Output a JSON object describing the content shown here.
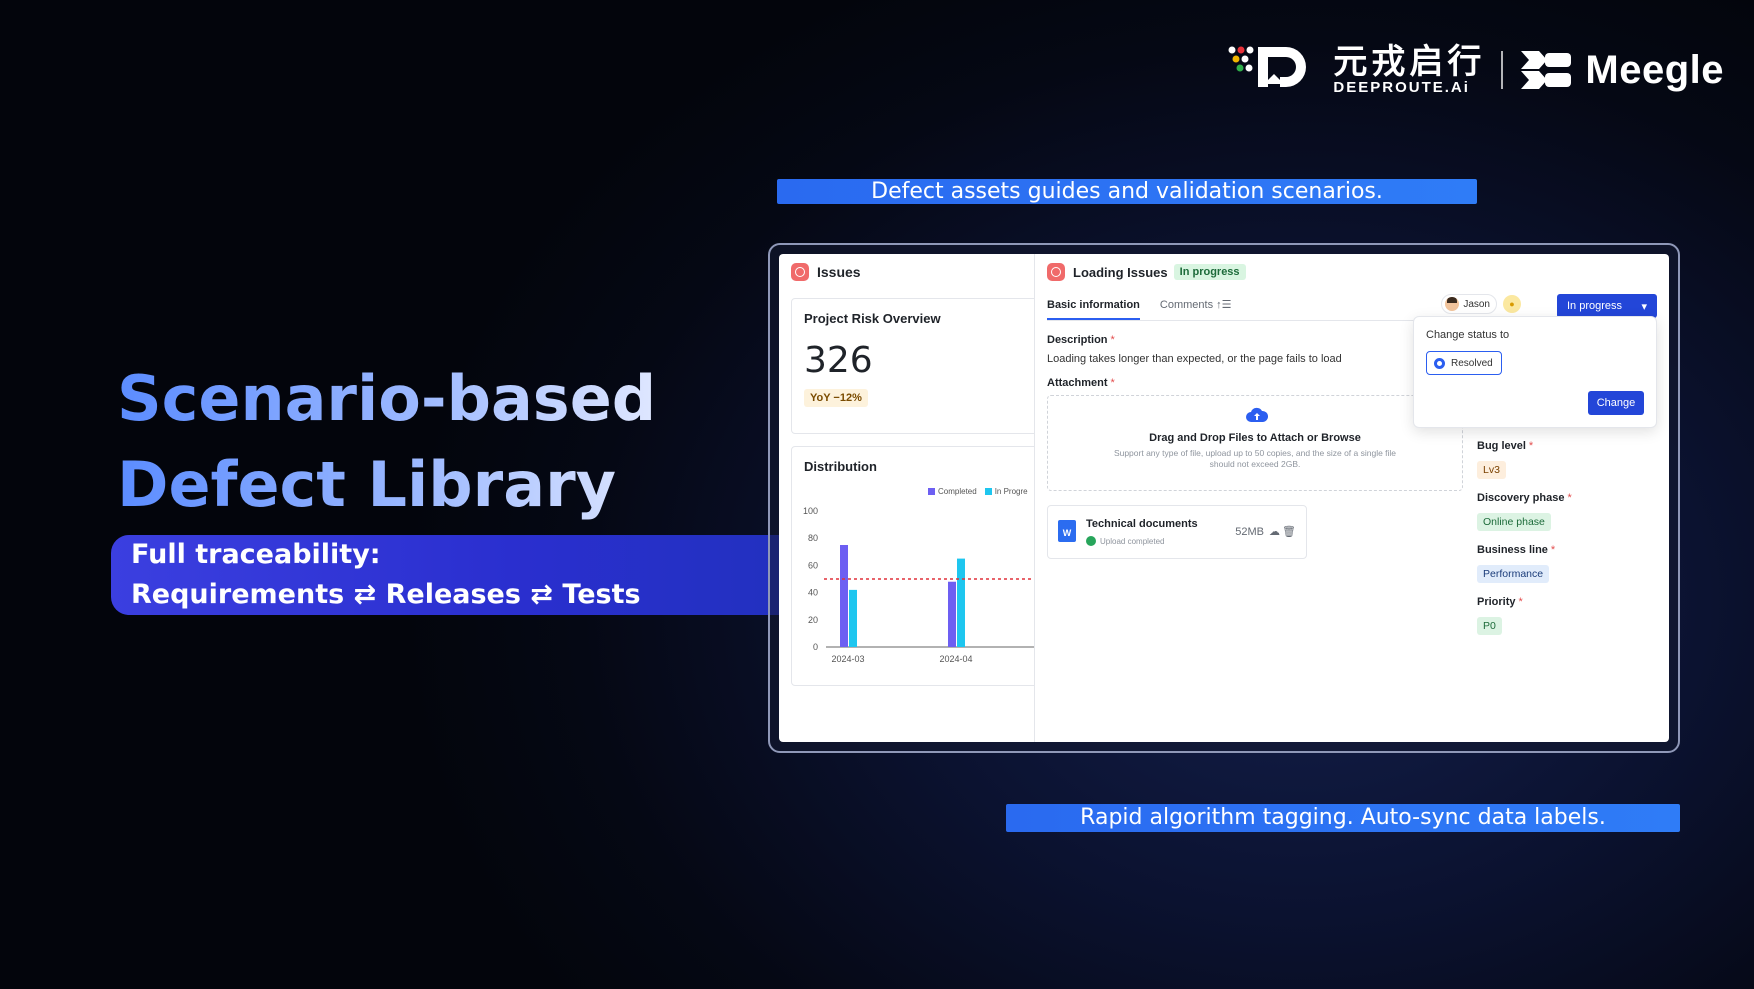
{
  "logos": {
    "deeproute_cn": "元戎启行",
    "deeproute_en": "DEEPROUTE.Ai",
    "meegle": "Meegle"
  },
  "captions": {
    "top": "Defect assets guides and validation scenarios.",
    "bottom": "Rapid algorithm tagging. Auto-sync data labels."
  },
  "headline": {
    "line1": "Scenario-based",
    "line2": "Defect Library"
  },
  "traceability": {
    "line1": "Full traceability:",
    "line2": "Requirements ⇄ Releases ⇄ Tests"
  },
  "left_panel": {
    "title": "Issues",
    "risk_card": {
      "title": "Project Risk Overview",
      "value": "326",
      "badge": "YoY −12%"
    },
    "distribution": {
      "title": "Distribution",
      "legend": [
        "Completed",
        "In Progre"
      ]
    }
  },
  "chart_data": {
    "type": "bar",
    "categories": [
      "2024-03",
      "2024-04"
    ],
    "series": [
      {
        "name": "Completed",
        "values": [
          75,
          48
        ],
        "color": "#6d5ff2"
      },
      {
        "name": "In Progress",
        "values": [
          42,
          65
        ],
        "color": "#1ec6ef"
      }
    ],
    "yticks": [
      0,
      20,
      40,
      60,
      80,
      100
    ],
    "ylim": [
      0,
      100
    ],
    "reference_line": 50,
    "reference_color": "#e0303a"
  },
  "issue": {
    "title": "Loading Issues",
    "status_badge": "In progress",
    "tabs": [
      "Basic information",
      "Comments ↑☰"
    ],
    "user": "Jason",
    "bell_icon": "bell-icon",
    "status_button": "In progress",
    "description_label": "Description",
    "description_value": "Loading takes longer than expected, or the page fails to load",
    "attachment_label": "Attachment",
    "dropzone_title": "Drag and Drop Files to Attach or Browse",
    "dropzone_sub": "Support any type of file, upload up to 50 copies, and the size of a single file should not exceed 2GB.",
    "file": {
      "name": "Technical documents",
      "status": "Upload completed",
      "size": "52MB",
      "type_letter": "W"
    },
    "popover": {
      "title": "Change status to",
      "option": "Resolved",
      "button": "Change"
    },
    "fields": [
      {
        "label": "Bug level",
        "value": "Lv3",
        "color": "orange"
      },
      {
        "label": "Discovery phase",
        "value": "Online phase",
        "color": "green"
      },
      {
        "label": "Business line",
        "value": "Performance",
        "color": "blue"
      },
      {
        "label": "Priority",
        "value": "P0",
        "color": "green"
      }
    ]
  }
}
